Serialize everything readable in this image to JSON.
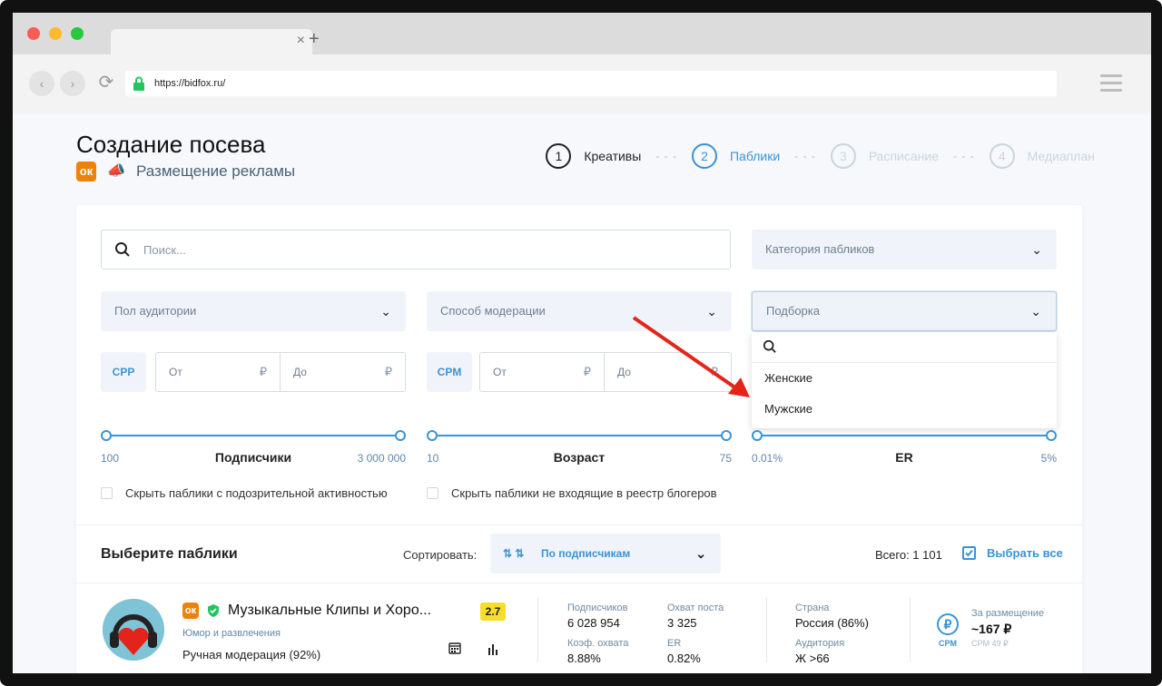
{
  "browser": {
    "url": "https://bidfox.ru/",
    "tab_close": "×",
    "new_tab": "+",
    "back": "‹",
    "forward": "›",
    "reload": "⟳"
  },
  "page": {
    "title": "Создание посева",
    "subtitle": "Размещение рекламы",
    "network_badge": "ok",
    "steps": [
      {
        "num": "1",
        "label": "Креативы"
      },
      {
        "num": "2",
        "label": "Паблики"
      },
      {
        "num": "3",
        "label": "Расписание"
      },
      {
        "num": "4",
        "label": "Медиаплан"
      }
    ],
    "step_sep": "- - -"
  },
  "filters": {
    "search_placeholder": "Поиск...",
    "category": "Категория пабликов",
    "gender": "Пол аудитории",
    "moderation": "Способ модерации",
    "collection": "Подборка",
    "dropdown_options": [
      "Женские",
      "Мужские"
    ],
    "cpp": {
      "label": "CPP",
      "from": "От",
      "to": "До",
      "currency": "₽"
    },
    "cpm": {
      "label": "CPM",
      "from": "От",
      "to": "До",
      "currency": "₽"
    },
    "sliders": [
      {
        "min": "100",
        "label": "Подписчики",
        "max": "3 000 000"
      },
      {
        "min": "10",
        "label": "Возраст",
        "max": "75"
      },
      {
        "min": "0.01%",
        "label": "ER",
        "max": "5%"
      }
    ],
    "checkbox_1": "Скрыть паблики с подозрительной активностью",
    "checkbox_2": "Скрыть паблики не входящие в реестр блогеров"
  },
  "list": {
    "heading": "Выберите паблики",
    "sort_label": "Сортировать:",
    "sort_value": "По подписчикам",
    "total": "Всего: 1 101",
    "select_all": "Выбрать все",
    "item": {
      "name": "Музыкальные Клипы и Хоро...",
      "category": "Юмор и развлечения",
      "moderation": "Ручная модерация (92%)",
      "rating": "2.7",
      "subscribers_label": "Подписчиков",
      "subscribers": "6 028 954",
      "reach_label": "Охват поста",
      "reach": "3 325",
      "reach_coef_label": "Коэф. охвата",
      "reach_coef": "8.88%",
      "er_label": "ER",
      "er": "0.82%",
      "country_label": "Страна",
      "country": "Россия (86%)",
      "audience_label": "Аудитория",
      "audience": "Ж >66",
      "price_label": "За размещение",
      "price": "~167 ₽",
      "cpm_small": "CPM 49 ₽",
      "cpm_badge": "CPM",
      "rub": "₽"
    }
  },
  "colors": {
    "accent": "#3a93d6",
    "ok_orange": "#ee8208",
    "rating_yellow": "#f7dd2a",
    "arrow_red": "#e3241b"
  }
}
